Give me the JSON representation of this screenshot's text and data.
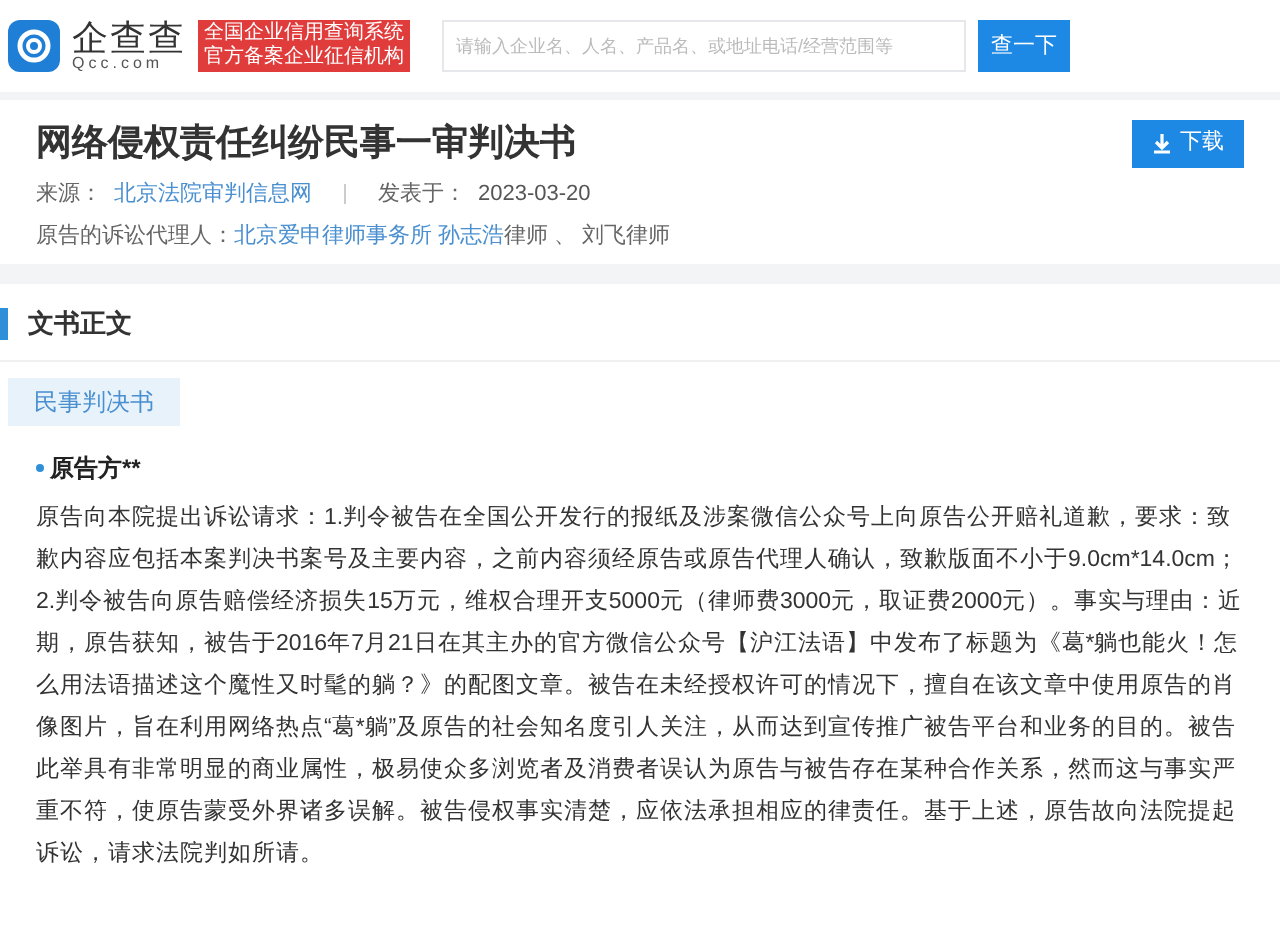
{
  "header": {
    "logo_name": "企查查",
    "logo_domain": "Qcc.com",
    "badge_lines": [
      "全国企业信用查询系统",
      "官方备案企业征信机构"
    ],
    "search": {
      "placeholder": "请输入企业名、人名、产品名、或地址电话/经营范围等"
    },
    "search_button": "查一下"
  },
  "document": {
    "title": "网络侵权责任纠纷民事一审判决书",
    "download_button": "下载",
    "meta": [
      {
        "label": "来源：",
        "value": "北京法院审判信息网",
        "kind": "link"
      },
      {
        "label": "发表于：",
        "value": "2023-03-20",
        "kind": "text"
      }
    ],
    "agents": {
      "label": "原告的诉讼代理人：",
      "links": [
        "北京爱申律师事务所",
        "孙志浩"
      ],
      "rest": "律师 、 刘飞律师"
    }
  },
  "body": {
    "section_title": "文书正文",
    "tag": "民事判决书",
    "party_heading": "原告方**",
    "paragraph": "原告向本院提出诉讼请求：1.判令被告在全国公开发行的报纸及涉案微信公众号上向原告公开赔礼道歉，要求：致歉内容应包括本案判决书案号及主要内容，之前内容须经原告或原告代理人确认，致歉版面不小于9.0cm*14.0cm；2.判令被告向原告赔偿经济损失15万元，维权合理开支5000元（律师费3000元，取证费2000元）。事实与理由：近期，原告获知，被告于2016年7月21日在其主办的官方微信公众号【沪江法语】中发布了标题为《葛*躺也能火！怎么用法语描述这个魔性又时髦的躺？》的配图文章。被告在未经授权许可的情况下，擅自在该文章中使用原告的肖像图片，旨在利用网络热点“葛*躺”及原告的社会知名度引人关注，从而达到宣传推广被告平台和业务的目的。被告此举具有非常明显的商业属性，极易使众多浏览者及消费者误认为原告与被告存在某种合作关系，然而这与事实严重不符，使原告蒙受外界诸多误解。被告侵权事实清楚，应依法承担相应的律责任。基于上述，原告故向法院提起诉讼，请求法院判如所请。"
  }
}
